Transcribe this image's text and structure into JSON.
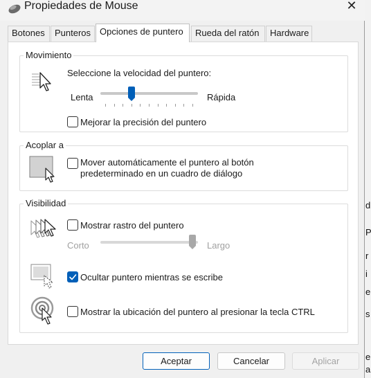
{
  "window": {
    "title": "Propiedades de Mouse",
    "close_glyph": "✕"
  },
  "tabs": [
    {
      "label": "Botones",
      "active": false
    },
    {
      "label": "Punteros",
      "active": false
    },
    {
      "label": "Opciones de puntero",
      "active": true
    },
    {
      "label": "Rueda del ratón",
      "active": false
    },
    {
      "label": "Hardware",
      "active": false
    }
  ],
  "motion": {
    "title": "Movimiento",
    "prompt": "Seleccione la velocidad del puntero:",
    "slow_label": "Lenta",
    "fast_label": "Rápida",
    "speed_level": 0.3,
    "precision_label": "Mejorar la precisión del puntero",
    "precision_checked": false,
    "icon": "pointer-speed-icon"
  },
  "snap": {
    "title": "Acoplar a",
    "label_line1": "Mover automáticamente el puntero al botón",
    "label_line2": "predeterminado en un cuadro de diálogo",
    "checked": false,
    "icon": "snap-to-default-icon"
  },
  "visibility": {
    "title": "Visibilidad",
    "trails_label": "Mostrar rastro del puntero",
    "trails_checked": false,
    "short_label": "Corto",
    "long_label": "Largo",
    "trail_length_level": 1.0,
    "hide_label": "Ocultar puntero mientras se escribe",
    "hide_checked": true,
    "ctrl_label": "Mostrar la ubicación del puntero al presionar la tecla CTRL",
    "ctrl_checked": false,
    "icons": [
      "pointer-trails-icon",
      "hide-while-typing-icon",
      "show-location-icon"
    ]
  },
  "buttons": {
    "ok": "Aceptar",
    "cancel": "Cancelar",
    "apply": "Aplicar"
  },
  "background_fragments": [
    "d",
    "P",
    "r",
    "i",
    "e",
    "s",
    "e",
    "a"
  ],
  "colors": {
    "accent": "#005fb8",
    "window_bg": "#f0f0f0",
    "panel_bg": "#ffffff"
  }
}
